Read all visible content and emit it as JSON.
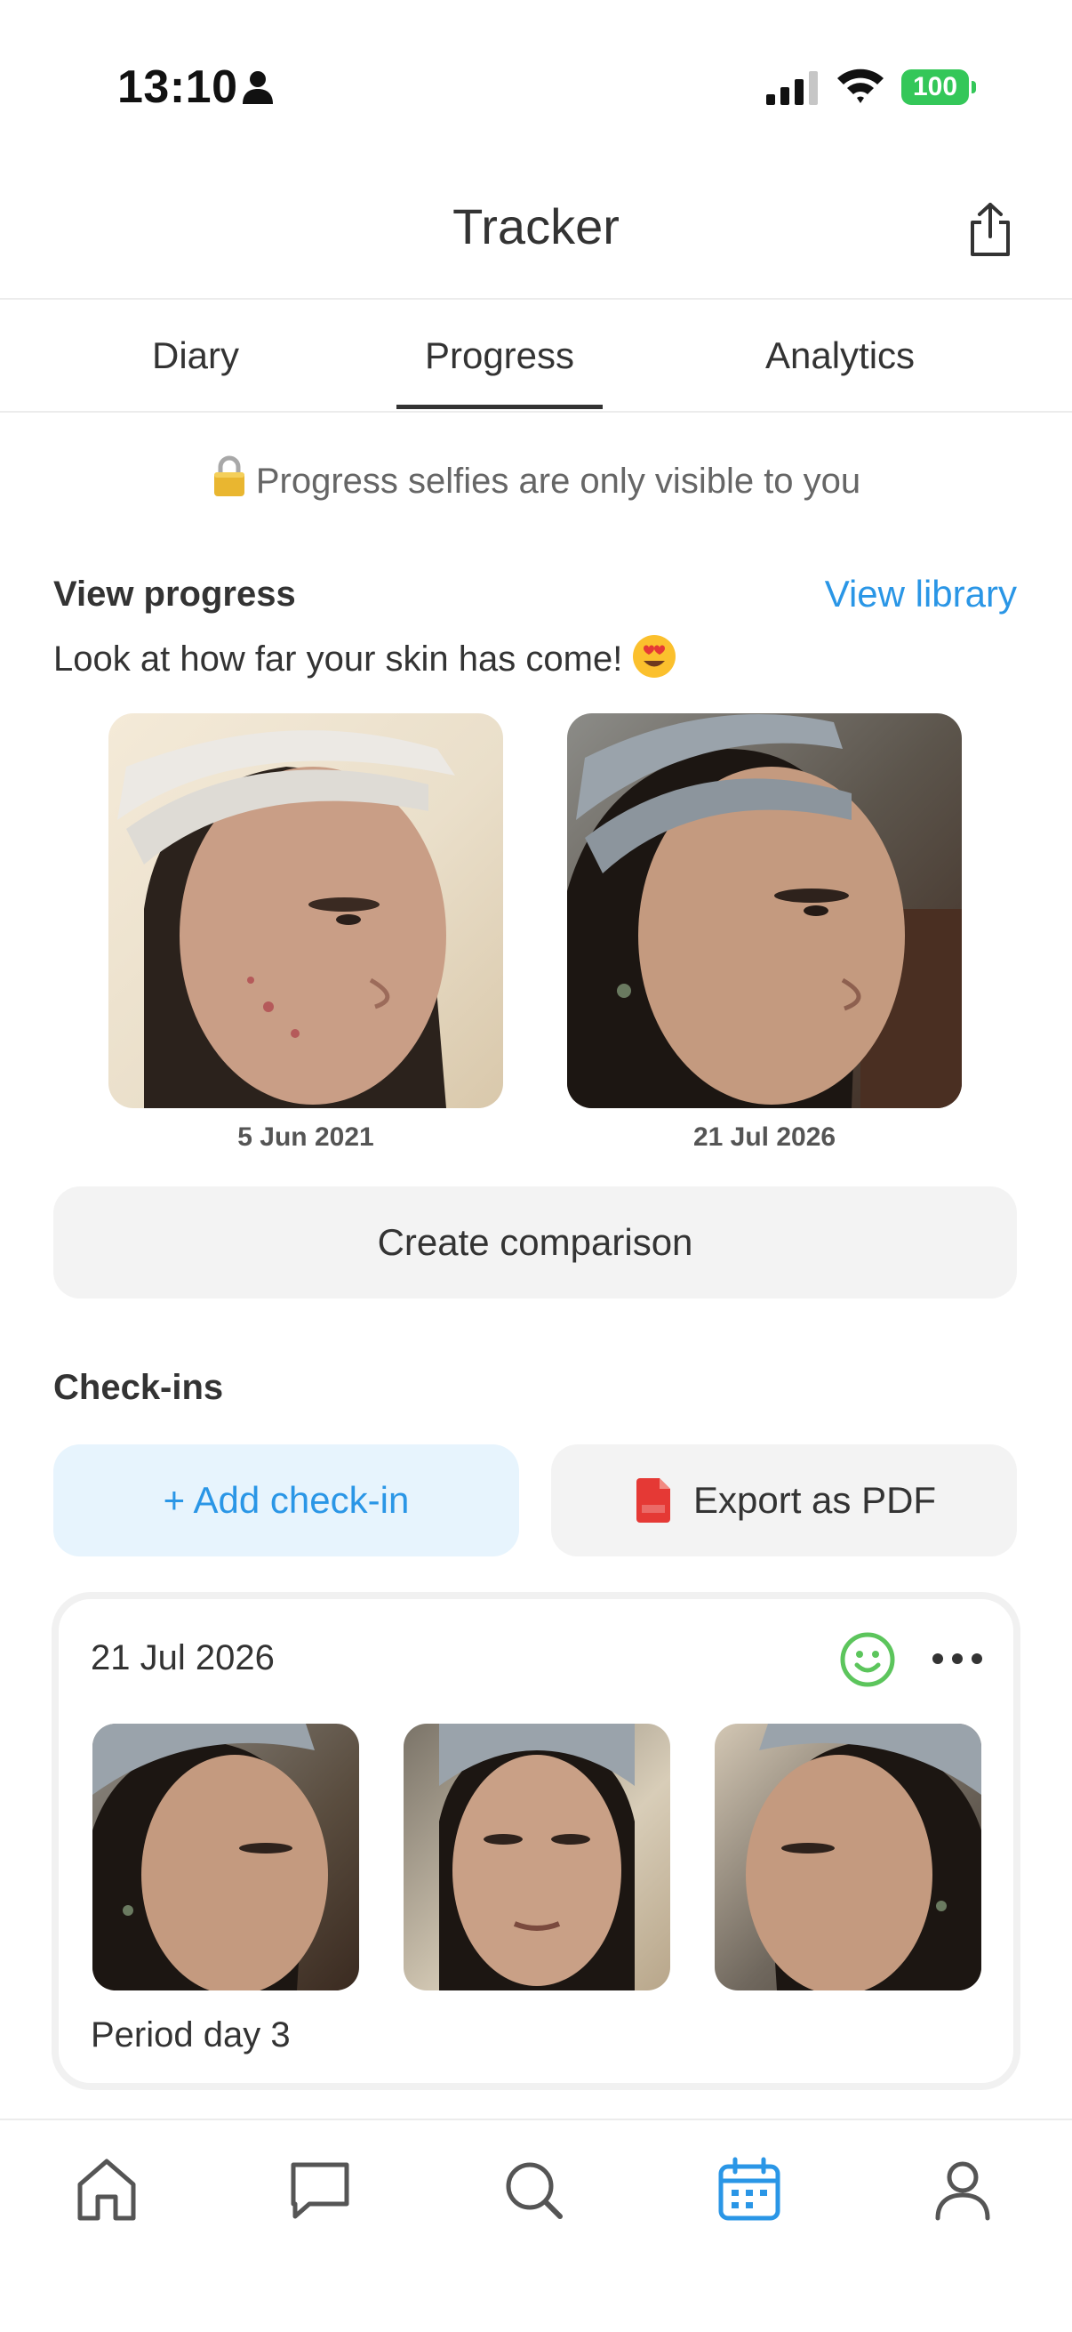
{
  "status_bar": {
    "time": "13:10",
    "battery": "100"
  },
  "header": {
    "title": "Tracker"
  },
  "tabs": [
    {
      "label": "Diary"
    },
    {
      "label": "Progress"
    },
    {
      "label": "Analytics"
    }
  ],
  "active_tab": "Progress",
  "privacy_note": "Progress selfies are only visible to you",
  "view_progress": {
    "title": "View progress",
    "link": "View library",
    "subtitle": "Look at how far your skin has come!",
    "photos": [
      {
        "date": "5 Jun 2021"
      },
      {
        "date": "21 Jul 2026"
      }
    ],
    "compare_button": "Create comparison"
  },
  "checkins": {
    "title": "Check-ins",
    "add_button": "+ Add check-in",
    "export_button": "Export as PDF",
    "card": {
      "date": "21 Jul 2026",
      "note": "Period day 3"
    }
  },
  "colors": {
    "accent": "#2a96e6",
    "accent_bg": "#e7f4fd",
    "battery": "#34c759",
    "smile": "#5cc55c",
    "pdf": "#e53935"
  },
  "icons": {
    "nav": [
      "home-icon",
      "chat-icon",
      "search-icon",
      "calendar-icon",
      "profile-icon"
    ]
  }
}
